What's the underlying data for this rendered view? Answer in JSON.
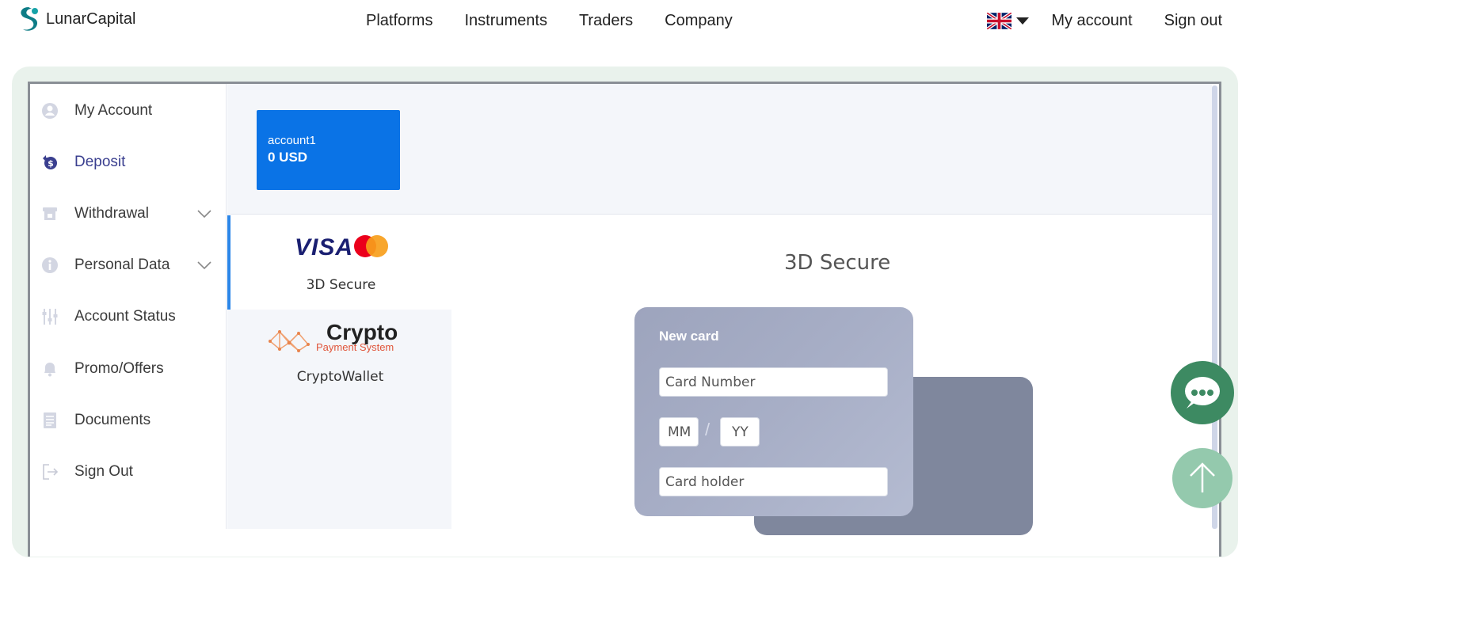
{
  "brand": {
    "name": "LunarCapital"
  },
  "nav": {
    "items": [
      "Platforms",
      "Instruments",
      "Traders",
      "Company"
    ],
    "my_account": "My account",
    "sign_out": "Sign out",
    "language": "en-GB"
  },
  "sidebar": {
    "items": [
      {
        "label": "My Account",
        "icon": "user-circle-icon"
      },
      {
        "label": "Deposit",
        "icon": "deposit-icon",
        "active": true
      },
      {
        "label": "Withdrawal",
        "icon": "withdrawal-icon",
        "expandable": true
      },
      {
        "label": "Personal Data",
        "icon": "info-icon",
        "expandable": true
      },
      {
        "label": "Account Status",
        "icon": "sliders-icon"
      },
      {
        "label": "Promo/Offers",
        "icon": "bell-icon"
      },
      {
        "label": "Documents",
        "icon": "document-icon"
      },
      {
        "label": "Sign Out",
        "icon": "sign-out-icon"
      }
    ]
  },
  "account": {
    "name": "account1",
    "balance": "0 USD"
  },
  "payment_methods": [
    {
      "label": "3D Secure",
      "logo": "visa-mastercard",
      "active": true
    },
    {
      "label": "CryptoWallet",
      "logo": "crypto-payment-system",
      "logo_title": "Crypto",
      "logo_subtitle": "Payment System"
    }
  ],
  "visa_text": "VISA",
  "form": {
    "title": "3D Secure",
    "card_title": "New card",
    "card_number_placeholder": "Card Number",
    "month_placeholder": "MM",
    "year_placeholder": "YY",
    "holder_placeholder": "Card holder",
    "date_separator": "/"
  },
  "colors": {
    "accent_blue": "#0a73e6",
    "sidebar_active": "#3a3f8f",
    "chat_green": "#3d8a62",
    "up_green": "#94c9ad"
  }
}
